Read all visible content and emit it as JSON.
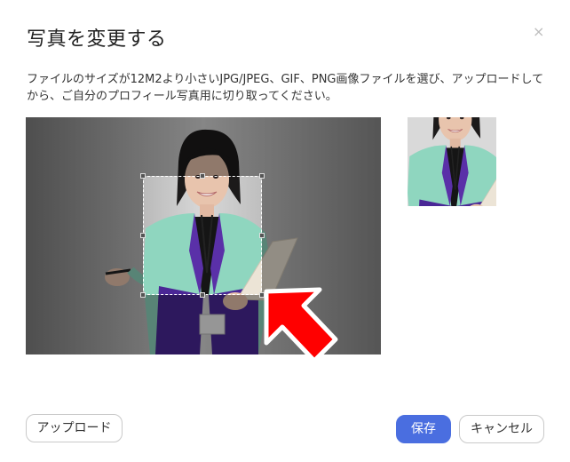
{
  "dialog": {
    "title": "写真を変更する",
    "close_glyph": "×",
    "description": "ファイルのサイズが12M2より小さいJPG/JPEG、GIF、PNG画像ファイルを選び、アップロードしてから、ご自分のプロフィール写真用に切り取ってください。"
  },
  "buttons": {
    "upload_label": "アップロード",
    "save_label": "保存",
    "cancel_label": "キャンセル"
  },
  "colors": {
    "primary": "#4a6ee0",
    "annotation_arrow": "#ff0000"
  },
  "icons": {
    "close": "close-icon",
    "annotation": "red-arrow-icon"
  }
}
